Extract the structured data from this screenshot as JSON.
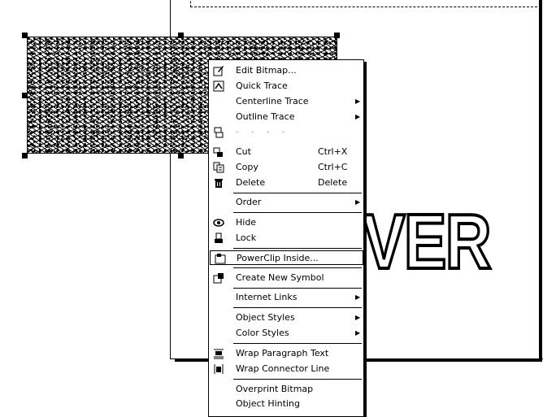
{
  "canvas": {
    "big_text": "VER"
  },
  "menu": {
    "items": [
      {
        "label": "Edit Bitmap...",
        "icon": "edit-bitmap-icon"
      },
      {
        "label": "Quick Trace",
        "icon": "quick-trace-icon"
      },
      {
        "label": "Centerline Trace",
        "submenu": true
      },
      {
        "label": "Outline Trace",
        "submenu": true
      },
      {
        "label": "· · · ·",
        "icon": "resample-icon",
        "disabled": true
      },
      {
        "label": "Cut",
        "shortcut": "Ctrl+X",
        "icon": "cut-icon"
      },
      {
        "label": "Copy",
        "shortcut": "Ctrl+C",
        "icon": "copy-icon"
      },
      {
        "label": "Delete",
        "shortcut": "Delete",
        "icon": "trash-icon"
      },
      {
        "label": "Order",
        "submenu": true
      },
      {
        "label": "Hide",
        "icon": "eye-icon"
      },
      {
        "label": "Lock",
        "icon": "lock-icon"
      },
      {
        "label": "PowerClip Inside...",
        "icon": "powerclip-icon",
        "highlighted": true
      },
      {
        "label": "Create New Symbol",
        "icon": "symbol-icon"
      },
      {
        "label": "Internet Links",
        "submenu": true
      },
      {
        "label": "Object Styles",
        "submenu": true
      },
      {
        "label": "Color Styles",
        "submenu": true
      },
      {
        "label": "Wrap Paragraph Text",
        "icon": "wrap-paragraph-icon"
      },
      {
        "label": "Wrap Connector Line",
        "icon": "wrap-connector-icon"
      },
      {
        "label": "Overprint Bitmap"
      },
      {
        "label": "Object Hinting"
      }
    ],
    "arrow_glyph": "▶"
  }
}
